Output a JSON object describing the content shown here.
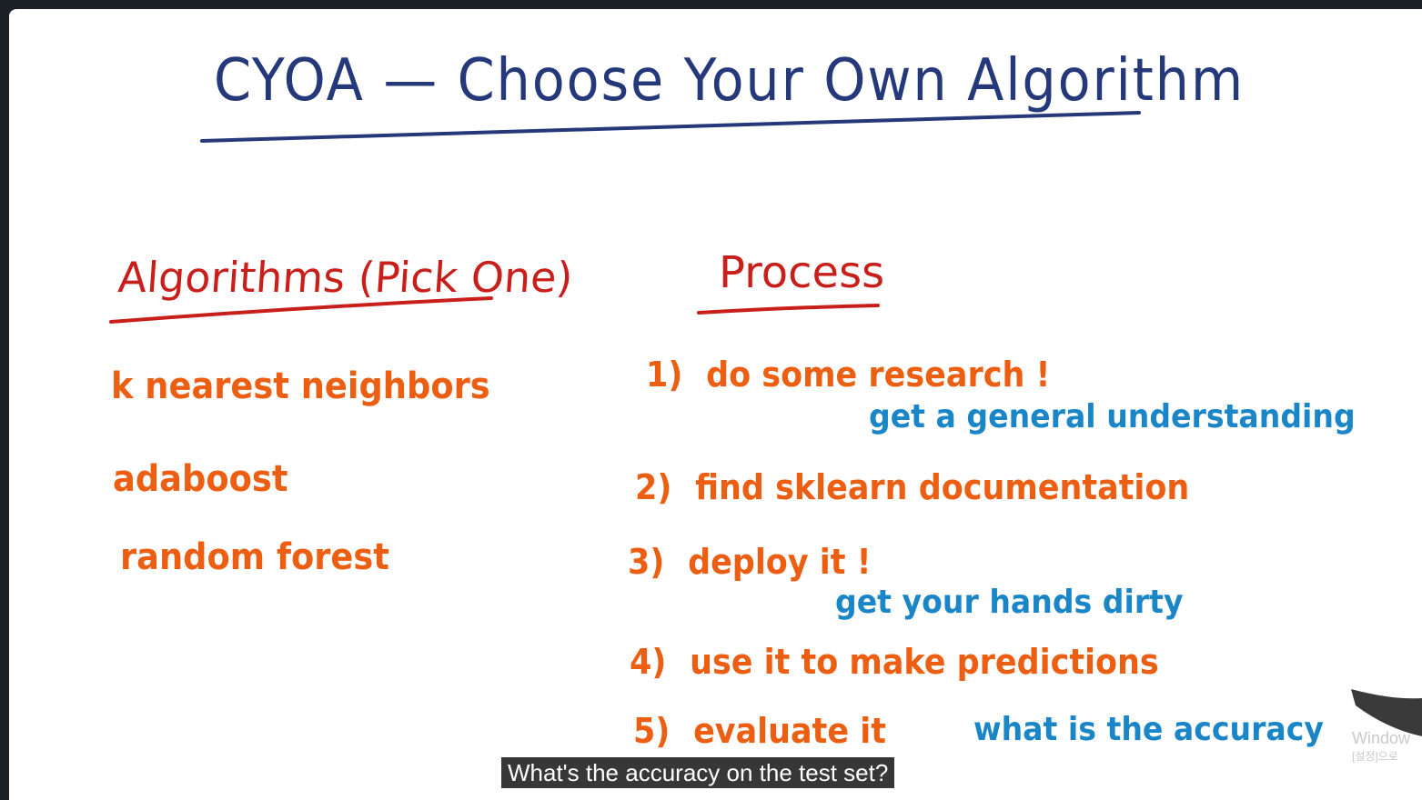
{
  "title": "CYOA — Choose Your Own Algorithm",
  "algorithms": {
    "heading": "Algorithms (Pick One)",
    "items": [
      "k nearest neighbors",
      "adaboost",
      "random forest"
    ]
  },
  "process": {
    "heading": "Process",
    "steps": [
      {
        "num": "1)",
        "text": "do some research !",
        "note": "get a general understanding"
      },
      {
        "num": "2)",
        "text": "find sklearn documentation"
      },
      {
        "num": "3)",
        "text": "deploy it !",
        "note": "get your hands dirty"
      },
      {
        "num": "4)",
        "text": "use it to make predictions"
      },
      {
        "num": "5)",
        "text": "evaluate it",
        "note": "what is the accuracy"
      }
    ]
  },
  "caption": "What's the accuracy on the test set?",
  "watermark": {
    "line1": "Window",
    "line2": "[설정]으로"
  },
  "colors": {
    "title": "#24387a",
    "headings": "#c81f1b",
    "items": "#ec5e12",
    "notes": "#1a86c7",
    "caption_bg": "#141414"
  }
}
